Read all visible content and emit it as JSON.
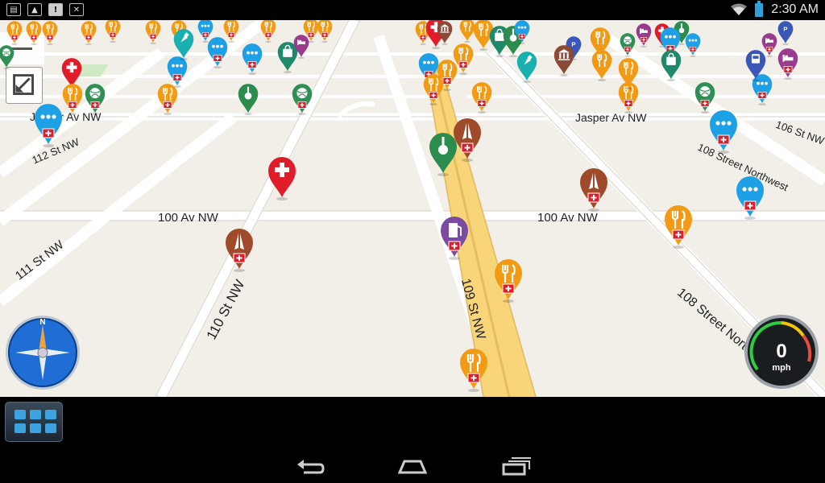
{
  "status_bar": {
    "time": "2:30 AM",
    "icons": [
      "screen-cast-icon",
      "image-icon",
      "alert-icon",
      "close-box-icon",
      "wifi-icon",
      "battery-icon"
    ]
  },
  "map": {
    "street_labels": {
      "jasper_left": "Jasper Av NW",
      "jasper_right": "Jasper Av NW",
      "st112": "112 St NW",
      "st111": "111 St NW",
      "st110": "110 St NW",
      "st109": "109 St NW",
      "av100_left": "100 Av NW",
      "av100_right": "100 Av NW",
      "st108": "108 Street Northwest",
      "st108_upper": "108 Street Northwest",
      "av106": "106 St NW"
    }
  },
  "speedometer": {
    "value": "0",
    "unit": "mph"
  },
  "compass": {
    "north_label": "N"
  },
  "colors": {
    "restaurant": "#f39a14",
    "chat": "#1ea0e6",
    "hospital": "#e01b2a",
    "worship": "#a04a2c",
    "music": "#2b8c4e",
    "fuel": "#7a4ba0",
    "shopping": "#1f8a6b",
    "sports": "#2f8f55",
    "attraction": "#1bb0b0",
    "parking": "#3a57b8",
    "museum": "#8a4a35",
    "hotel": "#9a3b8e",
    "transit": "#3a57b8",
    "road_highlight": "#f9d57a"
  }
}
